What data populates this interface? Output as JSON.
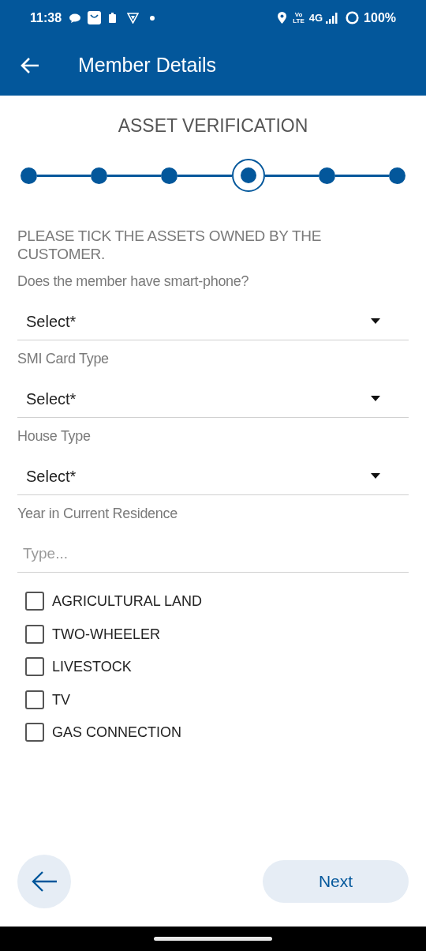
{
  "status_bar": {
    "time": "11:38",
    "volte_top": "Vo",
    "volte_bottom": "LTE",
    "network": "4G",
    "battery": "100%"
  },
  "app_bar": {
    "title": "Member Details"
  },
  "section_title": "ASSET VERIFICATION",
  "steps": [
    {
      "selected": false
    },
    {
      "selected": false
    },
    {
      "selected": false
    },
    {
      "selected": true
    },
    {
      "selected": false
    },
    {
      "selected": false
    }
  ],
  "instruction": "PLEASE TICK THE ASSETS OWNED BY THE CUSTOMER.",
  "fields": [
    {
      "kind": "select",
      "label": "Does the member have smart-phone?",
      "value": "Select*"
    },
    {
      "kind": "select",
      "label": "SMI Card Type",
      "value": "Select*"
    },
    {
      "kind": "select",
      "label": "House Type",
      "value": "Select*"
    },
    {
      "kind": "text",
      "label": "Year in Current Residence",
      "placeholder": "Type..."
    }
  ],
  "assets": [
    {
      "label": "AGRICULTURAL LAND",
      "checked": false
    },
    {
      "label": "TWO-WHEELER",
      "checked": false
    },
    {
      "label": "LIVESTOCK",
      "checked": false
    },
    {
      "label": "TV",
      "checked": false
    },
    {
      "label": "GAS CONNECTION",
      "checked": false
    }
  ],
  "footer": {
    "next": "Next"
  }
}
